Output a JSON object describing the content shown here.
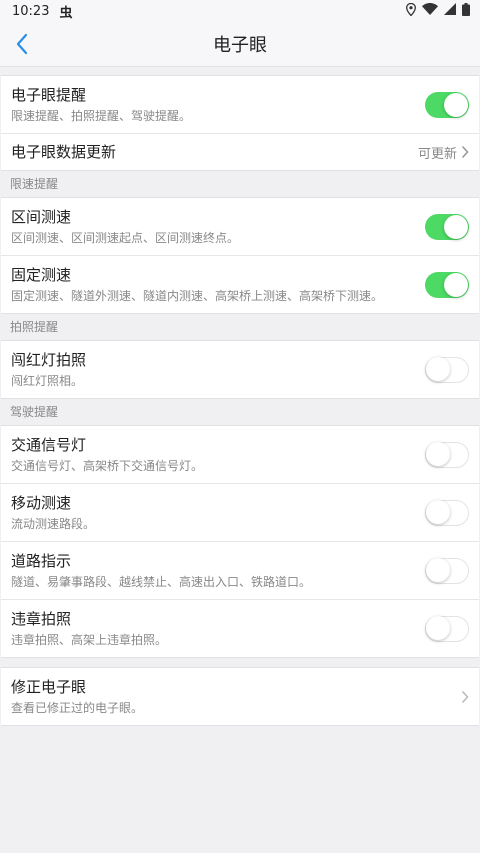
{
  "status_bar": {
    "time": "10:23",
    "app_glyph": "虫",
    "icons": [
      "location-icon",
      "wifi-icon",
      "signal-icon",
      "battery-icon"
    ]
  },
  "nav": {
    "back_icon": "chevron-left-icon",
    "title": "电子眼"
  },
  "colors": {
    "accent": "#2b8de3",
    "toggle_on": "#4cd964"
  },
  "main_alert": {
    "title": "电子眼提醒",
    "subtitle": "限速提醒、拍照提醒、驾驶提醒。",
    "enabled": true
  },
  "data_update": {
    "title": "电子眼数据更新",
    "status": "可更新"
  },
  "sections": {
    "speed": {
      "header": "限速提醒",
      "items": [
        {
          "title": "区间测速",
          "subtitle": "区间测速、区间测速起点、区间测速终点。",
          "enabled": true
        },
        {
          "title": "固定测速",
          "subtitle": "固定测速、隧道外测速、隧道内测速、高架桥上测速、高架桥下测速。",
          "enabled": true
        }
      ]
    },
    "photo": {
      "header": "拍照提醒",
      "items": [
        {
          "title": "闯红灯拍照",
          "subtitle": "闯红灯照相。",
          "enabled": false
        }
      ]
    },
    "driving": {
      "header": "驾驶提醒",
      "items": [
        {
          "title": "交通信号灯",
          "subtitle": "交通信号灯、高架桥下交通信号灯。",
          "enabled": false
        },
        {
          "title": "移动测速",
          "subtitle": "流动测速路段。",
          "enabled": false
        },
        {
          "title": "道路指示",
          "subtitle": "隧道、易肇事路段、越线禁止、高速出入口、铁路道口。",
          "enabled": false
        },
        {
          "title": "违章拍照",
          "subtitle": "违章拍照、高架上违章拍照。",
          "enabled": false
        }
      ]
    }
  },
  "corrections": {
    "title": "修正电子眼",
    "subtitle": "查看已修正过的电子眼。"
  }
}
